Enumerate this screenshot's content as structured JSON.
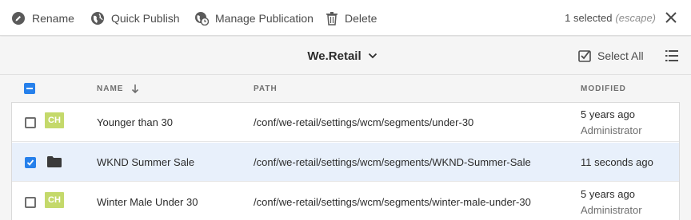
{
  "actions": {
    "rename": "Rename",
    "quick_publish": "Quick Publish",
    "manage_publication": "Manage Publication",
    "delete": "Delete"
  },
  "selection": {
    "count_text": "1 selected",
    "escape_hint": "(escape)"
  },
  "titlebar": {
    "title": "We.Retail",
    "select_all": "Select All"
  },
  "columns": {
    "name": "NAME",
    "path": "PATH",
    "modified": "MODIFIED"
  },
  "rows": [
    {
      "name": "Younger than 30",
      "path": "/conf/we-retail/settings/wcm/segments/under-30",
      "modified": "5 years ago",
      "modified_by": "Administrator",
      "thumb": "CH",
      "selected": false
    },
    {
      "name": "WKND Summer Sale",
      "path": "/conf/we-retail/settings/wcm/segments/WKND-Summer-Sale",
      "modified": "11 seconds ago",
      "modified_by": "",
      "thumb": "folder-icon",
      "selected": true
    },
    {
      "name": "Winter Male Under 30",
      "path": "/conf/we-retail/settings/wcm/segments/winter-male-under-30",
      "modified": "5 years ago",
      "modified_by": "Administrator",
      "thumb": "CH",
      "selected": false
    }
  ],
  "colors": {
    "accent": "#2680eb",
    "selected_row": "#e8f0fb",
    "thumb": "#c4d96b"
  }
}
